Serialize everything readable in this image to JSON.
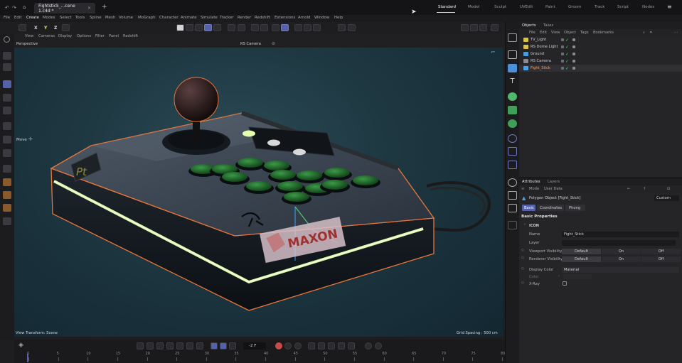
{
  "titlebar": {
    "document_tab": "Fightstick_...cene 1.c4d *",
    "layouts": [
      "Standard",
      "Model",
      "Sculpt",
      "UVEdit",
      "Paint",
      "Groom",
      "Track",
      "Script",
      "Nodes"
    ],
    "active_layout": "Standard"
  },
  "menubar": {
    "items": [
      "File",
      "Edit",
      "Create",
      "Modes",
      "Select",
      "Tools",
      "Spline",
      "Mesh",
      "Volume",
      "MoGraph",
      "Character",
      "Animate",
      "Simulate",
      "Tracker",
      "Render",
      "Redshift",
      "Extensions",
      "Arnold",
      "Window",
      "Help"
    ]
  },
  "toolbar": {
    "axis_labels": [
      "X",
      "Y",
      "Z"
    ]
  },
  "viewport": {
    "menu": [
      "View",
      "Cameras",
      "Display",
      "Options",
      "Filter",
      "Panel",
      "Redshift"
    ],
    "name": "Perspective",
    "camera": "RS Camera",
    "tool_label": "Move",
    "transform_status": "View Transform: Scene",
    "grid_spacing": "Grid Spacing : 500 cm",
    "product_logo": "MAXON",
    "decal_text": "Pt"
  },
  "timeline": {
    "current_frame": "-2 F",
    "ticks": [
      "0",
      "5",
      "10",
      "15",
      "20",
      "25",
      "30",
      "35",
      "40",
      "45",
      "50",
      "55",
      "60",
      "65",
      "70",
      "75",
      "80"
    ]
  },
  "objects_panel": {
    "tabs": [
      "Objects",
      "Takes"
    ],
    "active_tab": "Objects",
    "menu": [
      "File",
      "Edit",
      "View",
      "Object",
      "Tags",
      "Bookmarks"
    ],
    "objects": [
      {
        "name": "TV_Light",
        "icon_color": "#d9c34a"
      },
      {
        "name": "RS Dome Light",
        "icon_color": "#d9c34a"
      },
      {
        "name": "Ground",
        "icon_color": "#4a9ee0"
      },
      {
        "name": "RS Camera",
        "icon_color": "#8a8a90"
      },
      {
        "name": "Fight_Stick",
        "icon_color": "#4aa3e8",
        "selected": true
      }
    ]
  },
  "attributes_panel": {
    "tabs": [
      "Attributes",
      "Layers"
    ],
    "active_tab": "Attributes",
    "menu": [
      "Mode",
      "User Data"
    ],
    "object_title": "Polygon Object [Fight_Stick]",
    "preset": "Custom",
    "sub_tabs": [
      "Basic",
      "Coordinates",
      "Phong"
    ],
    "active_sub_tab": "Basic",
    "section_title": "Basic Properties",
    "group": "ICON",
    "name_label": "Name",
    "name_value": "Fight_Stick",
    "layer_label": "Layer",
    "viewport_visibility_label": "Viewport Visibility",
    "renderer_visibility_label": "Renderer Visibility",
    "visibility_options": [
      "Default",
      "On",
      "Off"
    ],
    "display_color_label": "Display Color",
    "display_color_value": "Material",
    "color_label": "Color",
    "xray_label": "X-Ray"
  },
  "colors": {
    "accent": "#5561a8",
    "check_green": "#4fc96a",
    "led_strip": "#d9f5a6",
    "selection_outline": "#e8763a",
    "button_green": "#1f6a2a"
  }
}
